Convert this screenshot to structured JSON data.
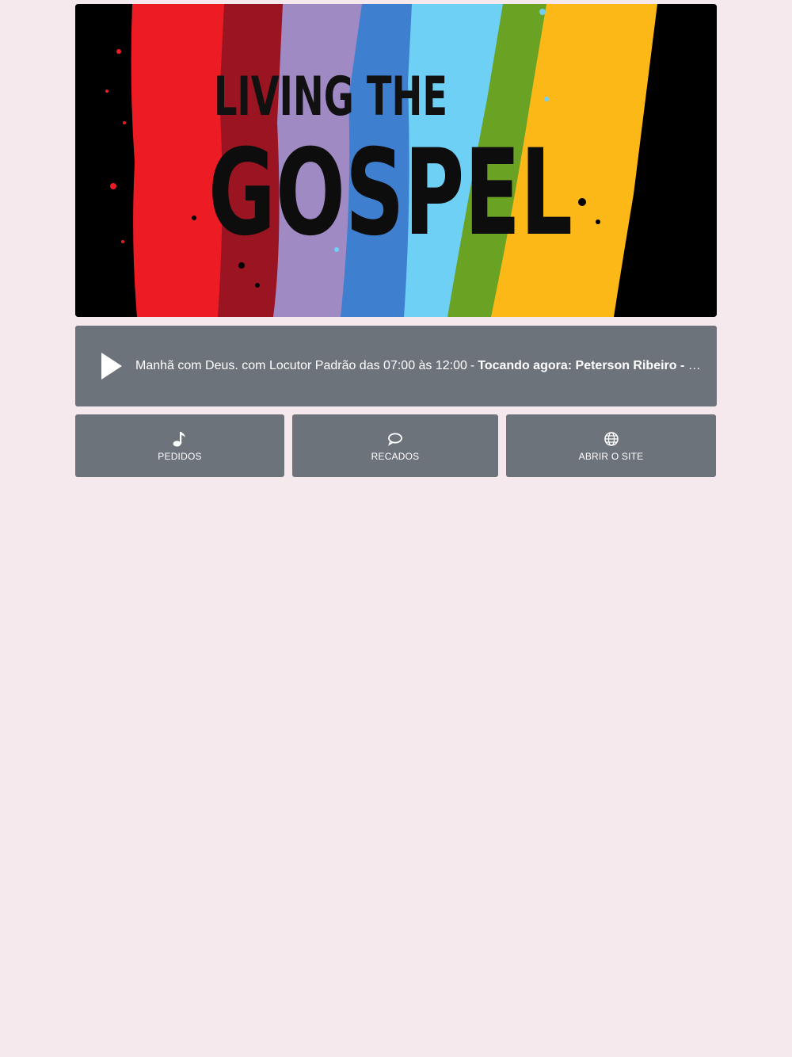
{
  "banner": {
    "title_top": "LIVING THE",
    "title_bottom": "GOSPEL",
    "stripe_colors": [
      "#ed1c24",
      "#9b1422",
      "#a08ac4",
      "#3f7fd0",
      "#6fd0f6",
      "#6aa224",
      "#fbb817"
    ]
  },
  "player": {
    "play_icon": "play-icon",
    "show_text": "Manhã com Deus. com Locutor Padrão das 07:00 às 12:00",
    "separator": "-",
    "now_playing": "Tocando agora: Peterson Ribeiro - Não Re..."
  },
  "buttons": [
    {
      "label": "PEDIDOS",
      "icon": "music-note-icon"
    },
    {
      "label": "RECADOS",
      "icon": "speech-bubble-icon"
    },
    {
      "label": "ABRIR O SITE",
      "icon": "globe-icon"
    }
  ],
  "colors": {
    "background": "#f5e9ee",
    "panel": "#6d737b",
    "text": "#ffffff"
  }
}
